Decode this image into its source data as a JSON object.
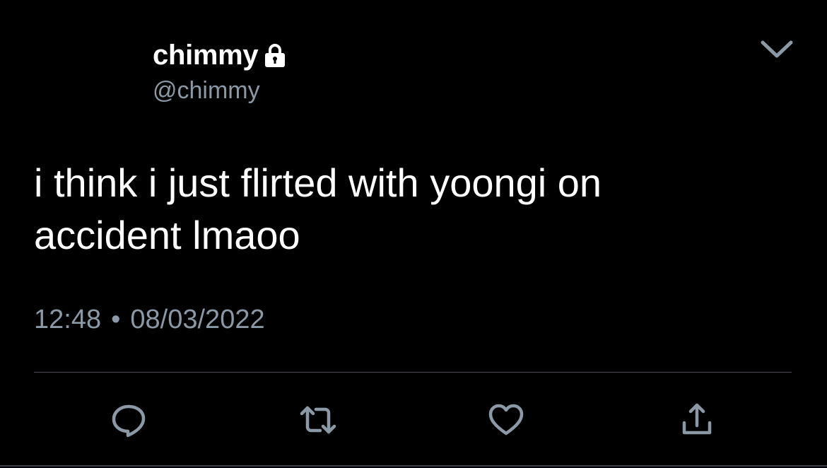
{
  "user": {
    "display_name": "chimmy",
    "handle": "@chimmy",
    "protected_icon": "lock-icon"
  },
  "tweet": {
    "text": "i think i just flirted with yoongi on\naccident lmaoo",
    "time": "12:48",
    "separator": "•",
    "date": "08/03/2022"
  },
  "actions": {
    "reply_icon": "reply-icon",
    "retweet_icon": "retweet-icon",
    "like_icon": "heart-icon",
    "share_icon": "share-icon"
  },
  "menu_icon": "chevron-down-icon",
  "colors": {
    "background": "#000000",
    "primary_text": "#ffffff",
    "secondary_text": "#8b98a5",
    "icon": "#8b98a5",
    "divider": "#4a4f55"
  }
}
